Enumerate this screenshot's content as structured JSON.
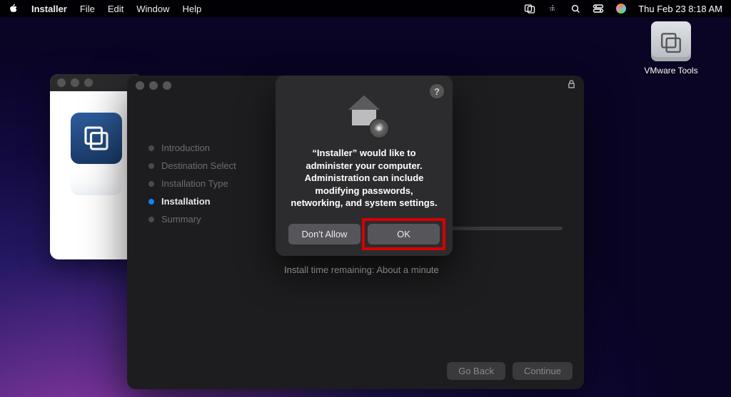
{
  "menubar": {
    "app": "Installer",
    "items": [
      "File",
      "Edit",
      "Window",
      "Help"
    ],
    "clock": "Thu Feb 23  8:18 AM"
  },
  "desktop": {
    "vmware_tools_label": "VMware Tools"
  },
  "installer": {
    "steps": [
      {
        "label": "Introduction",
        "active": false
      },
      {
        "label": "Destination Select",
        "active": false
      },
      {
        "label": "Installation Type",
        "active": false
      },
      {
        "label": "Installation",
        "active": true
      },
      {
        "label": "Summary",
        "active": false
      }
    ],
    "progress_pct": 60,
    "progress_text": "Install time remaining: About a minute",
    "go_back_label": "Go Back",
    "continue_label": "Continue"
  },
  "dialog": {
    "message": "“Installer” would like to administer your computer. Administration can include modifying passwords, networking, and system settings.",
    "dont_allow_label": "Don't Allow",
    "ok_label": "OK",
    "help_label": "?"
  }
}
